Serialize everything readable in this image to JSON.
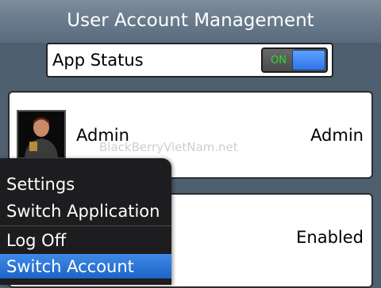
{
  "title": "User Account Management",
  "app_status": {
    "label": "App Status",
    "toggle_state_label": "ON"
  },
  "accounts": [
    {
      "name": "Admin",
      "role": "Admin"
    },
    {
      "status": "Enabled"
    }
  ],
  "watermark": "BlackBerryVietNam.net",
  "menu": {
    "items": [
      {
        "label": "Settings"
      },
      {
        "label": "Switch Application"
      },
      {
        "label": "Log Off"
      },
      {
        "label": "Switch Account"
      }
    ],
    "selected": "Switch Account"
  },
  "colors": {
    "title_bar": "#687a8c",
    "background": "#4e5f70",
    "toggle_on_text": "#2bd92b",
    "menu_highlight": "#1d64c8"
  }
}
